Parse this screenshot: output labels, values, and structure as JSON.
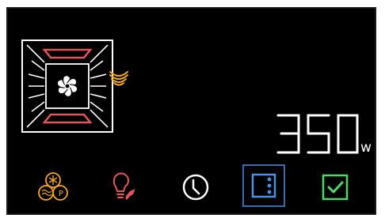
{
  "display": {
    "power_digits": "350",
    "power_unit": "w"
  },
  "icons": {
    "oven": "oven-convection-fan-icon",
    "microwave": "microwave-wave-icon",
    "fan_settings": "fan-settings-icon",
    "light": "eco-light-icon",
    "timer": "clock-icon",
    "menu": "menu-dots-icon",
    "confirm": "checkbox-confirm-icon"
  },
  "colors": {
    "background": "#000000",
    "oven_red": "#e2565a",
    "wave_orange": "#f5a623",
    "fan_orange": "#f5a623",
    "bulb_red": "#e2565a",
    "leaf_red": "#e2565a",
    "menu_blue": "#4a90e2",
    "check_green": "#4cd964",
    "white": "#ffffff"
  }
}
